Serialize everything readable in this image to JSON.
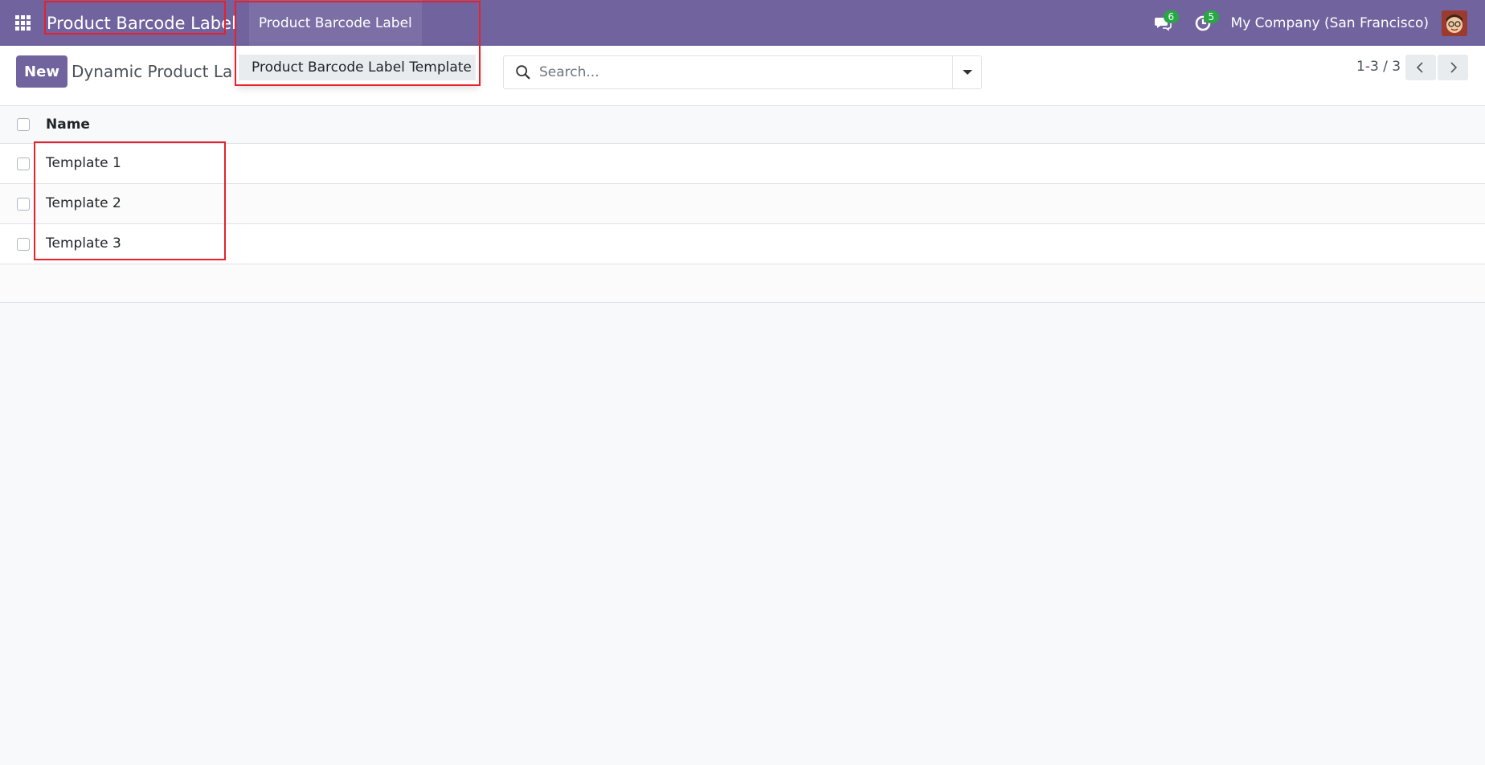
{
  "navbar": {
    "brand": "Product Barcode Label",
    "menu_top": "Product Barcode Label",
    "messages_count": "6",
    "activities_count": "5",
    "company": "My Company (San Francisco)"
  },
  "dropdown": {
    "items": [
      {
        "label": "Product Barcode Label Template"
      }
    ]
  },
  "control_panel": {
    "new_label": "New",
    "breadcrumb": "Dynamic Product Label",
    "search_placeholder": "Search...",
    "pager": "1-3 / 3"
  },
  "list": {
    "columns": [
      "Name"
    ],
    "rows": [
      {
        "name": "Template 1"
      },
      {
        "name": "Template 2"
      },
      {
        "name": "Template 3"
      }
    ]
  },
  "colors": {
    "navbar_bg": "#71639e",
    "annotation": "#e8202c",
    "badge": "#28a745"
  }
}
